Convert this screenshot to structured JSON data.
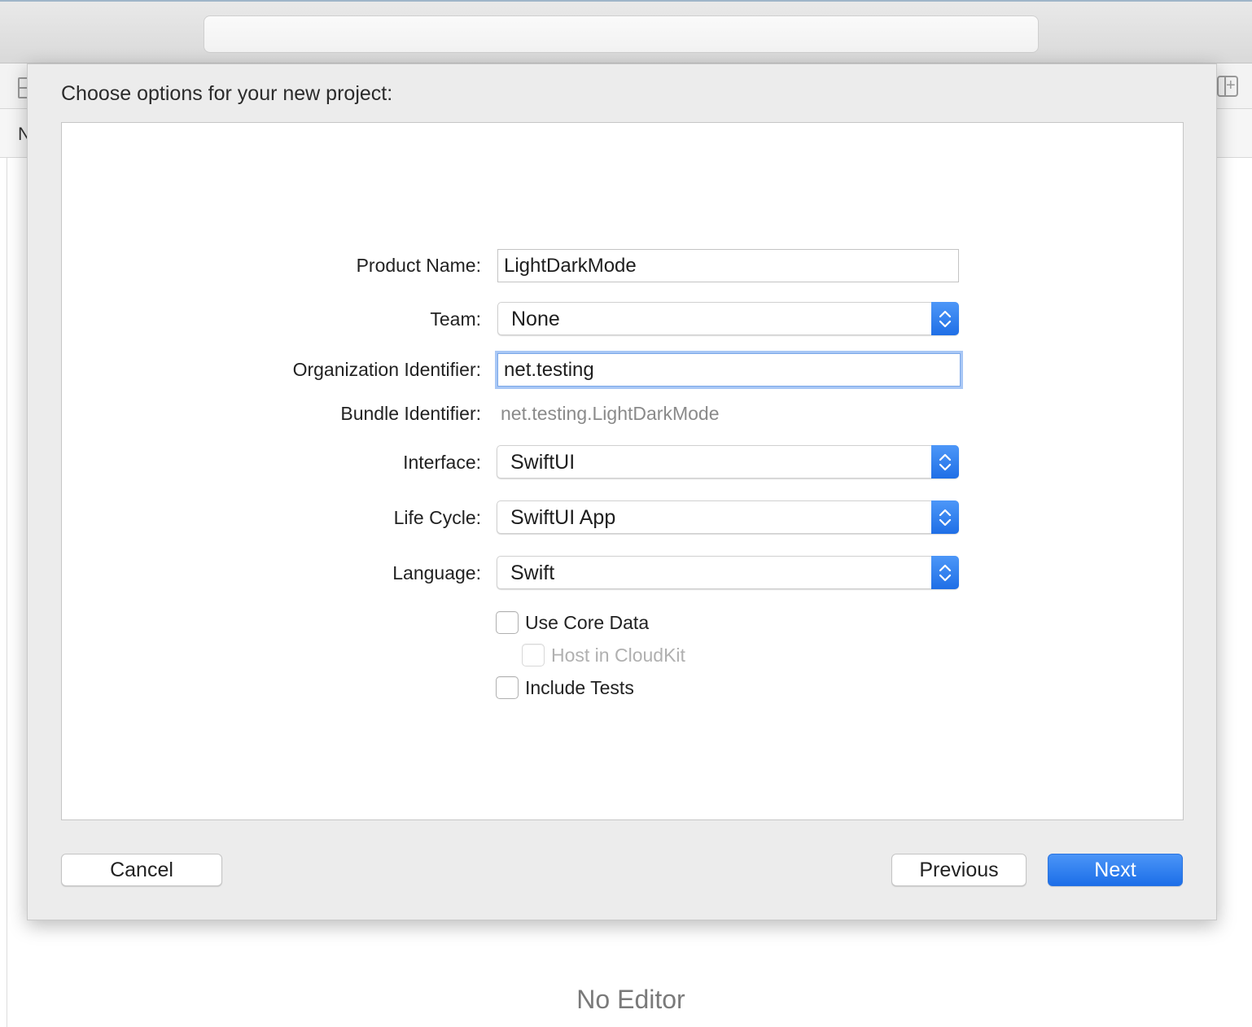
{
  "window": {
    "background_letter": "N",
    "no_editor_label": "No Editor"
  },
  "sheet": {
    "title": "Choose options for your new project:",
    "fields": {
      "product_name": {
        "label": "Product Name:",
        "value": "LightDarkMode"
      },
      "team": {
        "label": "Team:",
        "value": "None"
      },
      "organization_identifier": {
        "label": "Organization Identifier:",
        "value": "net.testing"
      },
      "bundle_identifier": {
        "label": "Bundle Identifier:",
        "value": "net.testing.LightDarkMode"
      },
      "interface": {
        "label": "Interface:",
        "value": "SwiftUI"
      },
      "life_cycle": {
        "label": "Life Cycle:",
        "value": "SwiftUI App"
      },
      "language": {
        "label": "Language:",
        "value": "Swift"
      }
    },
    "checkboxes": {
      "use_core_data": {
        "label": "Use Core Data",
        "checked": false,
        "enabled": true
      },
      "host_in_cloudkit": {
        "label": "Host in CloudKit",
        "checked": false,
        "enabled": false
      },
      "include_tests": {
        "label": "Include Tests",
        "checked": false,
        "enabled": true
      }
    },
    "buttons": {
      "cancel": "Cancel",
      "previous": "Previous",
      "next": "Next"
    }
  },
  "colors": {
    "accent": "#1f6fe6",
    "focus_ring": "#a8c7f5"
  },
  "icons": [
    "navigator-toggle-icon",
    "add-editor-icon",
    "chevron-up-down-icon"
  ]
}
